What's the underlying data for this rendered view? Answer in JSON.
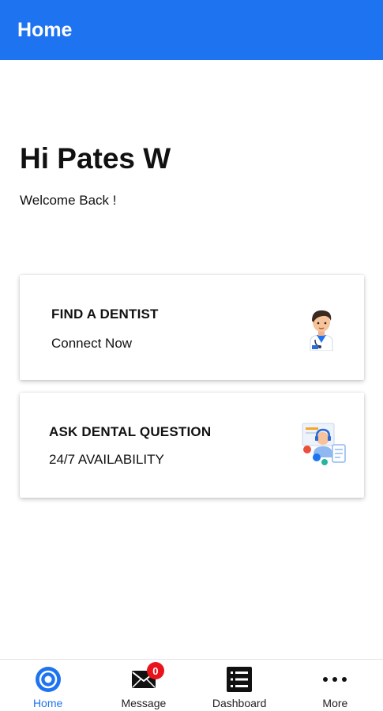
{
  "appbar": {
    "title": "Home"
  },
  "greeting": {
    "title": "Hi Pates W",
    "subtitle": "Welcome Back !"
  },
  "cards": [
    {
      "title": "FIND A DENTIST",
      "subtitle": "Connect Now",
      "icon": "doctor-icon"
    },
    {
      "title": "ASK DENTAL QUESTION",
      "subtitle": "24/7 AVAILABILITY",
      "icon": "support-agent-icon"
    }
  ],
  "bottom_nav": {
    "items": [
      {
        "label": "Home",
        "icon": "home-target-icon",
        "active": true
      },
      {
        "label": "Message",
        "icon": "mail-icon",
        "badge": "0"
      },
      {
        "label": "Dashboard",
        "icon": "list-icon"
      },
      {
        "label": "More",
        "icon": "more-dots-icon"
      }
    ]
  },
  "colors": {
    "primary": "#1e74f0",
    "badge": "#e8141c",
    "text": "#111111"
  }
}
